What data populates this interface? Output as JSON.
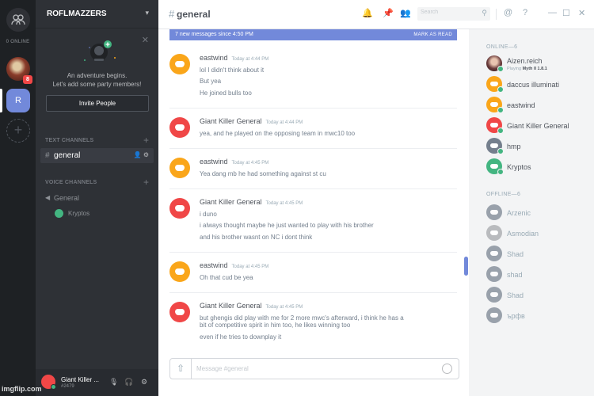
{
  "servers": {
    "online_count": "0 ONLINE",
    "mention_badge": "8",
    "selected_server_initial": "R"
  },
  "guild": {
    "name": "ROFLMAZZERS",
    "welcome_title": "An adventure begins.",
    "welcome_sub": "Let's add some party members!",
    "invite_label": "Invite People",
    "text_category": "TEXT CHANNELS",
    "voice_category": "VOICE CHANNELS",
    "text_channel": "general",
    "voice_channel": "General",
    "voice_user": "Kryptos"
  },
  "user": {
    "name": "Giant Killer ...",
    "tag": "#2479"
  },
  "chat": {
    "channel": "general",
    "new_messages": "7 new messages since 4:50 PM",
    "mark_read": "MARK AS READ",
    "composer_placeholder": "Message #general",
    "messages": [
      {
        "author": "eastwind",
        "time": "Today at 4:44 PM",
        "lines": [
          "lol I didn't think about it",
          "But yea",
          "He joined bulls too"
        ]
      },
      {
        "author": "Giant Killer General",
        "time": "Today at 4:44 PM",
        "lines": [
          "yea, and he played on the opposing team in mwc10 too"
        ]
      },
      {
        "author": "eastwind",
        "time": "Today at 4:45 PM",
        "lines": [
          "Yea dang mb he had something against st cu"
        ]
      },
      {
        "author": "Giant Killer General",
        "time": "Today at 4:45 PM",
        "lines": [
          "i duno",
          "i always thought maybe he just wanted to play with his brother",
          "and his brother wasnt on NC i dont think"
        ]
      },
      {
        "author": "eastwind",
        "time": "Today at 4:45 PM",
        "lines": [
          "Oh that cud be yea"
        ]
      },
      {
        "author": "Giant Killer General",
        "time": "Today at 4:45 PM",
        "lines": [
          "but ghengis did play with me for 2 more mwc's afterward, i think he has a",
          "bit of competitive spirit in him too, he likes winning too",
          "even if he tries to downplay it"
        ]
      }
    ]
  },
  "toolbar": {
    "search_placeholder": "Search"
  },
  "members": {
    "online_header": "ONLINE—6",
    "offline_header": "OFFLINE—6",
    "online": [
      {
        "name": "Aizen.reich",
        "playing_prefix": "Playing",
        "playing_game": "Myth II 1.8.1"
      },
      {
        "name": "daccus illuminati"
      },
      {
        "name": "eastwind"
      },
      {
        "name": "Giant Killer General"
      },
      {
        "name": "hmp"
      },
      {
        "name": "Kryptos"
      }
    ],
    "offline": [
      {
        "name": "Arzenic"
      },
      {
        "name": "Asmodian"
      },
      {
        "name": "Shad"
      },
      {
        "name": "shad"
      },
      {
        "name": "Shad"
      },
      {
        "name": "ърфв"
      }
    ]
  },
  "watermark": "imgflip.com",
  "colors": {
    "blurple": "#7289da",
    "online_green": "#43b581",
    "orange_avatar": "#faa61a",
    "red_avatar": "#f04747"
  }
}
